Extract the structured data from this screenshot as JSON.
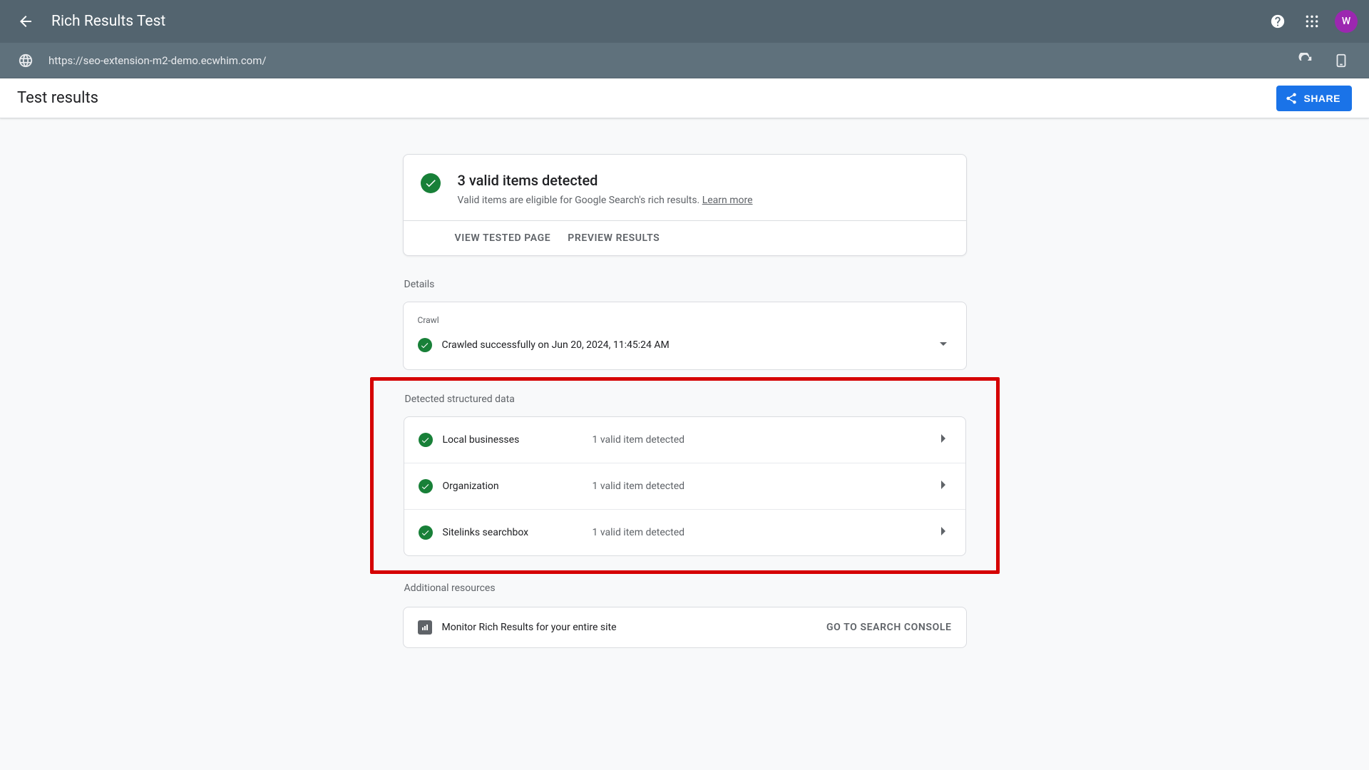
{
  "header": {
    "title": "Rich Results Test",
    "avatar_letter": "W"
  },
  "urlbar": {
    "url": "https://seo-extension-m2-demo.ecwhim.com/"
  },
  "subbar": {
    "title": "Test results",
    "share_label": "SHARE"
  },
  "summary": {
    "title": "3 valid items detected",
    "subtitle": "Valid items are eligible for Google Search's rich results. ",
    "learn_more": "Learn more",
    "view_tested": "VIEW TESTED PAGE",
    "preview_results": "PREVIEW RESULTS"
  },
  "details_label": "Details",
  "crawl": {
    "label": "Crawl",
    "text": "Crawled successfully on Jun 20, 2024, 11:45:24 AM"
  },
  "structured_label": "Detected structured data",
  "structured": [
    {
      "name": "Local businesses",
      "detail": "1 valid item detected"
    },
    {
      "name": "Organization",
      "detail": "1 valid item detected"
    },
    {
      "name": "Sitelinks searchbox",
      "detail": "1 valid item detected"
    }
  ],
  "resources_label": "Additional resources",
  "resource_row": {
    "text": "Monitor Rich Results for your entire site",
    "link": "GO TO SEARCH CONSOLE"
  }
}
